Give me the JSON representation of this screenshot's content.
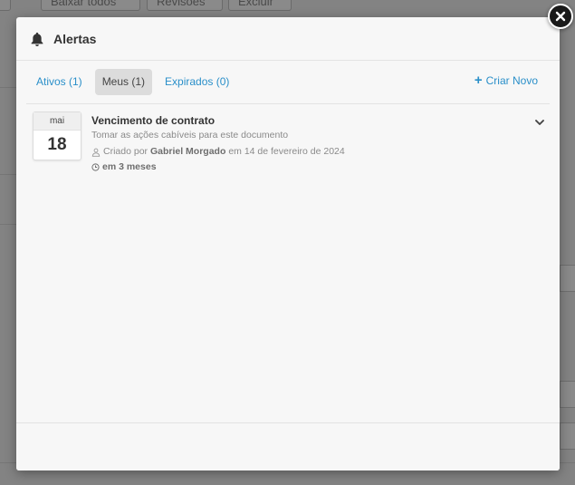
{
  "modal": {
    "title": "Alertas",
    "icon": "bell-icon",
    "tabs": [
      {
        "label": "Ativos (1)",
        "active": false
      },
      {
        "label": "Meus (1)",
        "active": true
      },
      {
        "label": "Expirados (0)",
        "active": false
      }
    ],
    "create_new_label": "Criar Novo",
    "alerts": [
      {
        "month": "mai",
        "day": "18",
        "title": "Vencimento de contrato",
        "description": "Tomar as ações cabíveis para este documento",
        "created_prefix": "Criado por",
        "created_by": "Gabriel Morgado",
        "created_suffix": "em 14 de fevereiro de 2024",
        "due_in": "em 3 meses"
      }
    ]
  },
  "background": {
    "toolbar_buttons": [
      "Baixar todos",
      "Revisões",
      "Excluir"
    ]
  },
  "colors": {
    "link": "#2a8fc9",
    "active_tab_bg": "#dcdcdc",
    "close_button": "#1a1a1a"
  }
}
